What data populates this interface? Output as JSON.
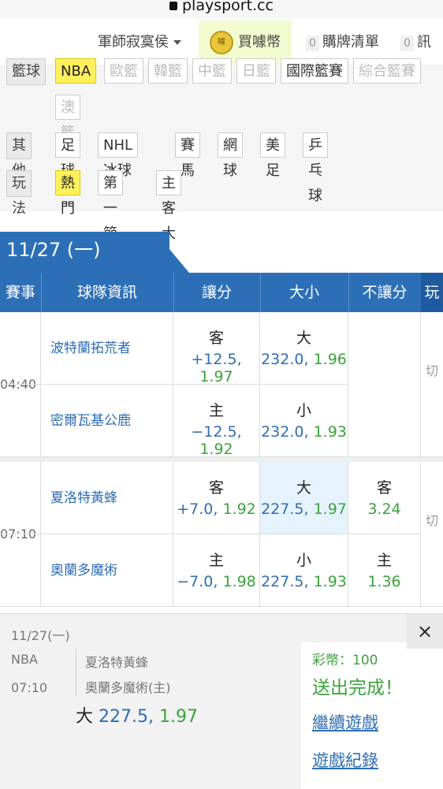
{
  "url": "playsport.cc",
  "nav": {
    "menu": "軍師寂寞侯",
    "buy_coin": "買噱幣",
    "coin_glyph": "噱",
    "cart_count": "0",
    "cart": "購牌清單",
    "msg_count": "0",
    "msg": "訊息"
  },
  "filters": {
    "row1_label": "籃球",
    "row1_tags": [
      "NBA",
      "歐籃",
      "韓籃",
      "中籃",
      "日籃",
      "國際籃賽",
      "綜合籃賽"
    ],
    "row1b_tags": [
      "澳籃"
    ],
    "row2_label": "其他",
    "row2_tags": [
      "足球",
      "NHL冰球",
      "賽馬",
      "網球",
      "美足",
      "乒乓球"
    ],
    "row3_label": "玩法",
    "row3_tags": [
      "熱門",
      "第一節",
      "主客大小"
    ]
  },
  "date_tab": "11/27 (一)",
  "table_headers": [
    "賽事",
    "球隊資訊",
    "讓分",
    "大小",
    "不讓分",
    "玩"
  ],
  "games": [
    {
      "time": "04:40",
      "away": "波特蘭拓荒者",
      "home": "密爾瓦基公鹿",
      "spread": [
        {
          "label": "客",
          "line": "+12.5,",
          "odds": "1.97"
        },
        {
          "label": "主",
          "line": "−12.5,",
          "odds": "1.92"
        }
      ],
      "total": [
        {
          "label": "大",
          "line": "232.0,",
          "odds": "1.96"
        },
        {
          "label": "小",
          "line": "232.0,",
          "odds": "1.93"
        }
      ],
      "ml": [],
      "switch": "切"
    },
    {
      "time": "07:10",
      "away": "夏洛特黃蜂",
      "home": "奧蘭多魔術",
      "spread": [
        {
          "label": "客",
          "line": "+7.0,",
          "odds": "1.92"
        },
        {
          "label": "主",
          "line": "−7.0,",
          "odds": "1.98"
        }
      ],
      "total": [
        {
          "label": "大",
          "line": "227.5,",
          "odds": "1.97"
        },
        {
          "label": "小",
          "line": "227.5,",
          "odds": "1.93"
        }
      ],
      "ml": [
        {
          "label": "客",
          "odds": "3.24"
        },
        {
          "label": "主",
          "odds": "1.36"
        }
      ],
      "switch": "切"
    }
  ],
  "popup": {
    "date": "11/27(一)",
    "league": "NBA",
    "time": "07:10",
    "team1": "夏洛特黃蜂",
    "team2": "奧蘭多魔術(主)",
    "pick_label": "大",
    "pick_line": "227.5,",
    "pick_odds": "1.97",
    "coins": "彩幣：100",
    "done": "送出完成！",
    "continue": "繼續遊戲",
    "record": "遊戲紀錄",
    "close": "×"
  },
  "colors": {
    "blue": "#2d6fb7",
    "green": "#3aa33a",
    "link": "#2f6db3",
    "highlight": "#fff15c"
  }
}
